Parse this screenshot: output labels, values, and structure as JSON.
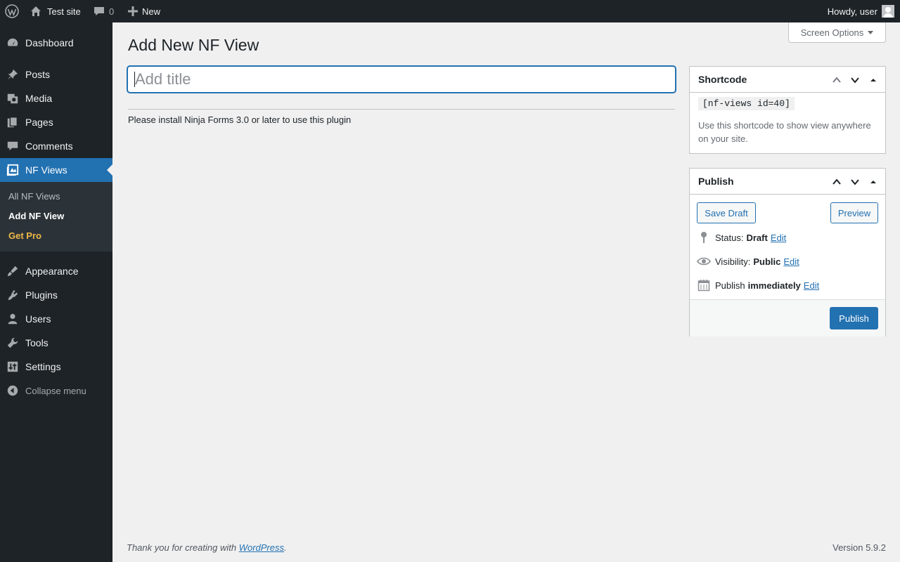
{
  "admin_bar": {
    "site_name": "Test site",
    "comments_count": "0",
    "new_label": "New",
    "howdy": "Howdy, user"
  },
  "sidebar": {
    "items": [
      {
        "label": "Dashboard",
        "icon": "dashboard-icon"
      },
      {
        "label": "Posts",
        "icon": "pin-icon"
      },
      {
        "label": "Media",
        "icon": "media-icon"
      },
      {
        "label": "Pages",
        "icon": "pages-icon"
      },
      {
        "label": "Comments",
        "icon": "comment-icon"
      },
      {
        "label": "NF Views",
        "icon": "nf-views-icon",
        "current": true
      },
      {
        "label": "Appearance",
        "icon": "brush-icon"
      },
      {
        "label": "Plugins",
        "icon": "plugin-icon"
      },
      {
        "label": "Users",
        "icon": "user-icon"
      },
      {
        "label": "Tools",
        "icon": "wrench-icon"
      },
      {
        "label": "Settings",
        "icon": "settings-icon"
      }
    ],
    "submenu": [
      "All NF Views",
      "Add NF View",
      "Get Pro"
    ],
    "collapse_label": "Collapse menu"
  },
  "screen_options": "Screen Options",
  "page_title": "Add New NF View",
  "title_input": {
    "placeholder": "Add title",
    "value": ""
  },
  "notice": "Please install Ninja Forms 3.0 or later to use this plugin",
  "shortcode_box": {
    "title": "Shortcode",
    "code": "[nf-views id=40]",
    "description": "Use this shortcode to show view anywhere on your site."
  },
  "publish_box": {
    "title": "Publish",
    "save_draft": "Save Draft",
    "preview": "Preview",
    "status_label": "Status:",
    "status_value": "Draft",
    "visibility_label": "Visibility:",
    "visibility_value": "Public",
    "publish_label": "Publish",
    "publish_value": "immediately",
    "edit_label": "Edit",
    "publish_button": "Publish"
  },
  "footer": {
    "thanks_prefix": "Thank you for creating with ",
    "thanks_link": "WordPress",
    "thanks_suffix": ".",
    "version": "Version 5.9.2"
  },
  "colors": {
    "accent": "#2271b1",
    "admin_bg": "#1d2327",
    "get_pro": "#f0b849"
  }
}
